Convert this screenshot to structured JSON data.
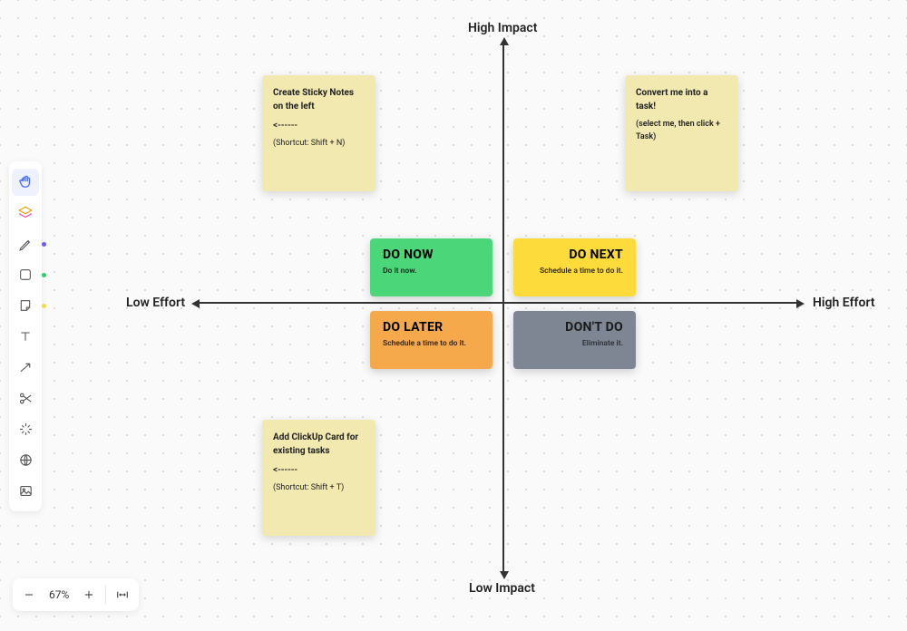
{
  "axis": {
    "top": "High Impact",
    "bottom": "Low Impact",
    "left": "Low Effort",
    "right": "High Effort"
  },
  "quadrants": {
    "do_now": {
      "title": "DO NOW",
      "sub": "Do it now.",
      "color": "#4bd67a"
    },
    "do_next": {
      "title": "DO NEXT",
      "sub": "Schedule a time to do it.",
      "color": "#fddb3a"
    },
    "do_later": {
      "title": "DO LATER",
      "sub": "Schedule a time to do it.",
      "color": "#f5a94b"
    },
    "dont_do": {
      "title": "DON'T DO",
      "sub": "Eliminate it.",
      "color": "#7e8593"
    }
  },
  "stickies": {
    "s1": {
      "title": "Create Sticky Notes on the left",
      "arrow": "<------",
      "hint": "(Shortcut: Shift + N)"
    },
    "s2": {
      "title": "Convert me into a task!",
      "hint": "(select me, then click + Task)"
    },
    "s3": {
      "title": "Add ClickUp Card for existing tasks",
      "arrow": "<------",
      "hint": "(Shortcut: Shift + T)"
    }
  },
  "toolbar": {
    "tools": [
      {
        "name": "hand",
        "active": true
      },
      {
        "name": "layers"
      },
      {
        "name": "pen",
        "dot": "#6b5cf6"
      },
      {
        "name": "shape",
        "dot": "#2ecc71"
      },
      {
        "name": "sticky",
        "dot": "#f2d94e"
      },
      {
        "name": "text"
      },
      {
        "name": "connector"
      },
      {
        "name": "scissors"
      },
      {
        "name": "ai-magic"
      },
      {
        "name": "web"
      },
      {
        "name": "image"
      }
    ]
  },
  "zoom": {
    "level": "67%"
  },
  "colors": {
    "sticky": "#f2e9b0"
  }
}
